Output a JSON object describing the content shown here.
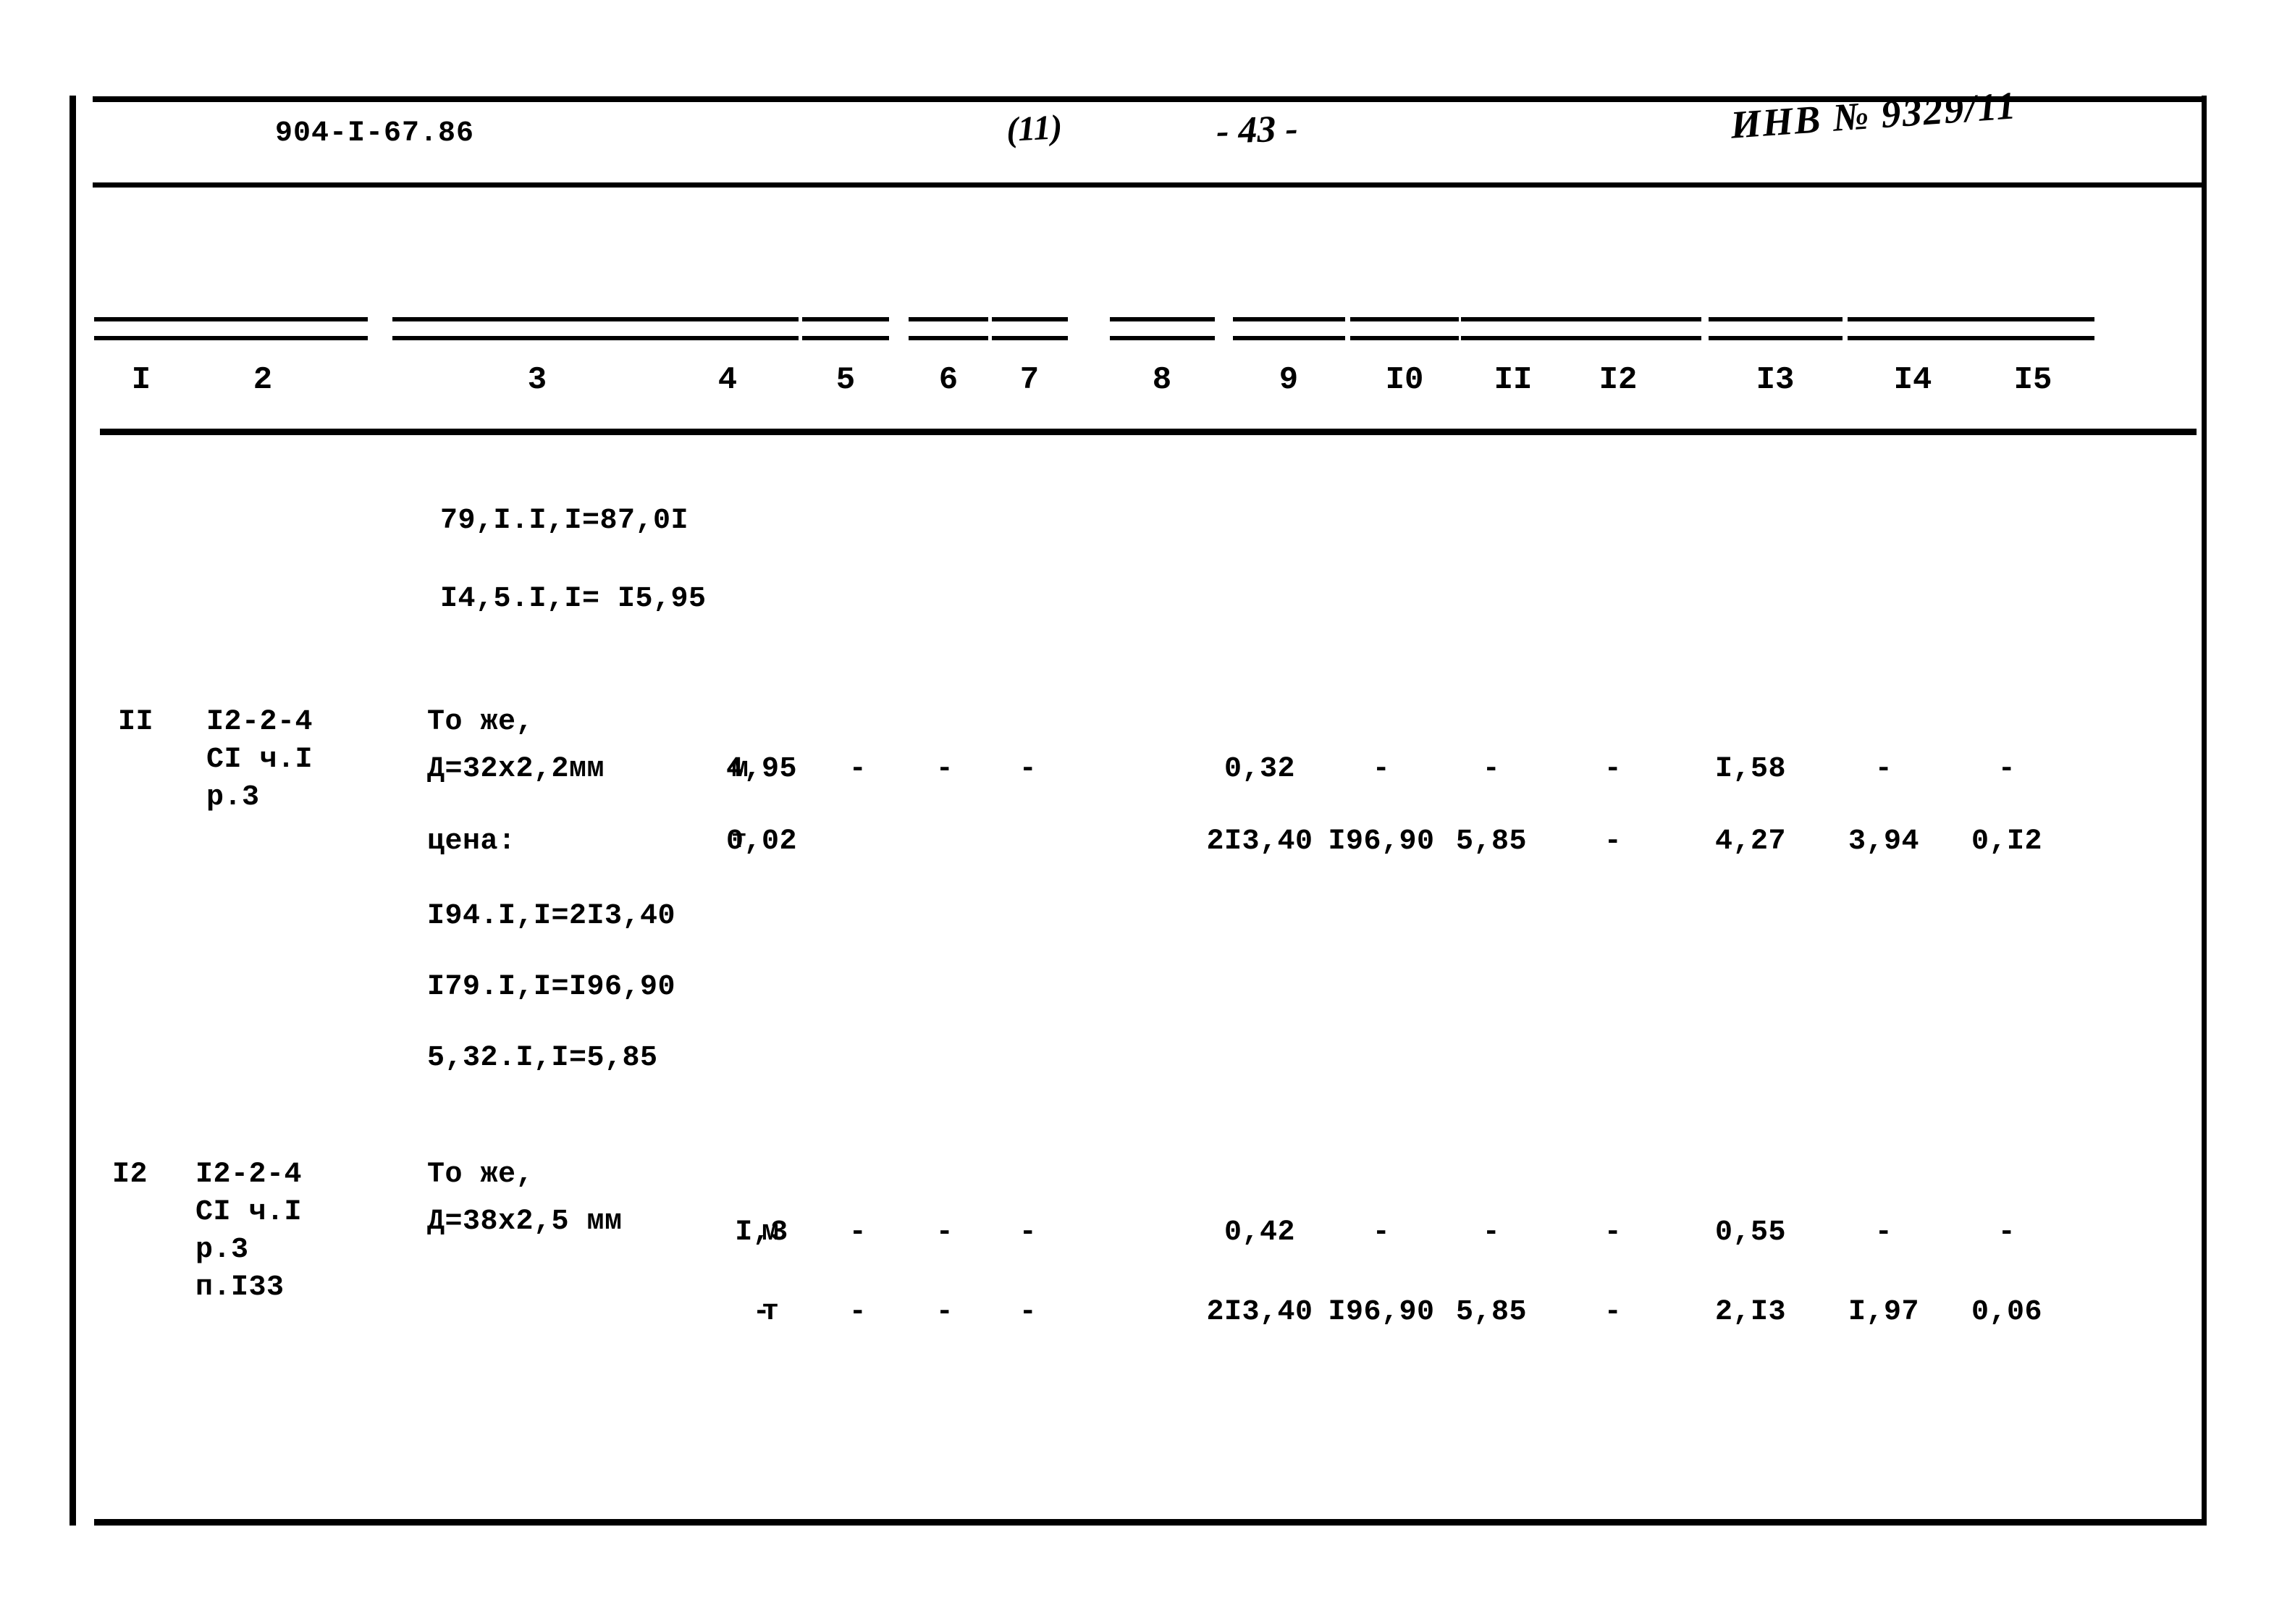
{
  "header": {
    "document_code": "904-I-67.86",
    "page_mark": "(11)",
    "page_number": "- 43 -",
    "inventory": "ИНВ № 9329/11"
  },
  "table": {
    "column_numbers": [
      "I",
      "2",
      "3",
      "4",
      "5",
      "6",
      "7",
      "8",
      "9",
      "I0",
      "II",
      "I2",
      "I3",
      "I4",
      "I5"
    ],
    "continued_lines": [
      "79,I.I,I=87,0I",
      "I4,5.I,I= I5,95"
    ],
    "rows": [
      {
        "pos": "II",
        "ref_lines": [
          "I2-2-4",
          "CI ч.I",
          "р.3"
        ],
        "name_lines": [
          "То же,",
          "Д=32х2,2мм"
        ],
        "price_label": "цена:",
        "unit_qty": {
          "unit": "м",
          "c4": "4,95",
          "c5": "-",
          "c6": "-",
          "c7": "-",
          "c8": "",
          "c9": "0,32",
          "c10": "-",
          "c11": "-",
          "c12": "-",
          "c13": "I,58",
          "c14": "-",
          "c15": "-"
        },
        "unit_price": {
          "unit": "т",
          "c4": "0,02",
          "c5": "",
          "c6": "",
          "c7": "",
          "c8": "",
          "c9": "2I3,40",
          "c10": "I96,90",
          "c11": "5,85",
          "c12": "-",
          "c13": "4,27",
          "c14": "3,94",
          "c15": "0,I2"
        },
        "formula_lines": [
          "I94.I,I=2I3,40",
          "I79.I,I=I96,90",
          "5,32.I,I=5,85"
        ]
      },
      {
        "pos": "I2",
        "ref_lines": [
          "I2-2-4",
          "CI ч.I",
          "р.3",
          "п.I33"
        ],
        "name_lines": [
          "То же,",
          "Д=38х2,5 мм"
        ],
        "price_label": "",
        "unit_qty": {
          "unit": "м",
          "c4": "I,3",
          "c5": "-",
          "c6": "-",
          "c7": "-",
          "c8": "",
          "c9": "0,42",
          "c10": "-",
          "c11": "-",
          "c12": "-",
          "c13": "0,55",
          "c14": "-",
          "c15": "-"
        },
        "unit_price": {
          "unit": "т",
          "c4": "-",
          "c5": "-",
          "c6": "-",
          "c7": "-",
          "c8": "",
          "c9": "2I3,40",
          "c10": "I96,90",
          "c11": "5,85",
          "c12": "-",
          "c13": "2,I3",
          "c14": "I,97",
          "c15": "0,06"
        },
        "formula_lines": []
      }
    ]
  }
}
